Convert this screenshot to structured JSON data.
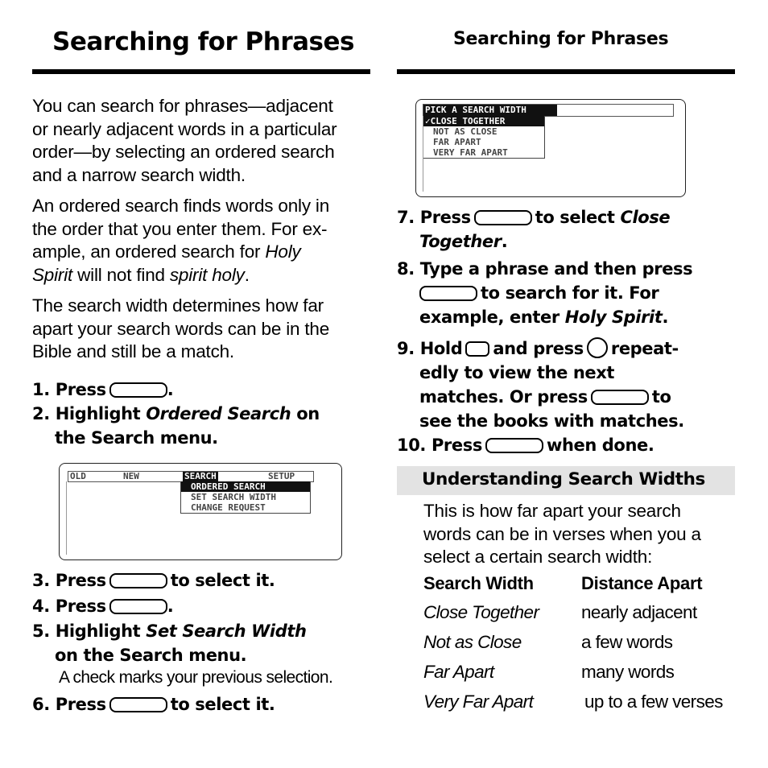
{
  "left": {
    "title": "Searching for Phrases",
    "paragraphs": [
      {
        "lines": [
          "You can search for phrases—adjacent",
          "or nearly adjacent words in a particular",
          "order—by selecting an ordered search",
          "and a narrow search width."
        ]
      },
      {
        "l1": "An ordered search finds words only in",
        "l2": "the order that you enter them. For ex-",
        "l3_pre": "ample, an ordered search for ",
        "l3_it": "Holy",
        "l4_it1": "Spirit",
        "l4_mid": " will not find ",
        "l4_it2": "spirit holy",
        "l4_end": "."
      },
      {
        "lines": [
          "The search width determines how far",
          "apart your search words can be in the",
          "Bible and still be a match."
        ]
      }
    ],
    "steps": {
      "s1": {
        "num": "1.",
        "pre": "Press",
        "post": "."
      },
      "s2": {
        "num": "2.",
        "pre": "Highlight ",
        "it": "Ordered Search",
        "post": " on",
        "cont": "the Search menu."
      },
      "s3": {
        "num": "3.",
        "pre": "Press",
        "post": "to select it."
      },
      "s4": {
        "num": "4.",
        "pre": "Press",
        "post": "."
      },
      "s5": {
        "num": "5.",
        "pre": "Highlight ",
        "it": "Set Search Width",
        "cont": "on the Search menu."
      },
      "s5_note": "A check marks your previous selection.",
      "s6": {
        "num": "6.",
        "pre": "Press",
        "post": "to select it."
      }
    },
    "screen1": {
      "menubar": [
        "OLD",
        "NEW",
        "SEARCH",
        "SETUP"
      ],
      "selected_menu": "SEARCH",
      "dropdown": [
        "ORDERED SEARCH",
        "SET SEARCH WIDTH",
        "CHANGE REQUEST"
      ],
      "selected_item": "ORDERED SEARCH"
    }
  },
  "right": {
    "title": "Searching for Phrases",
    "screen2": {
      "prompt": "PICK A SEARCH WIDTH",
      "options": [
        "✓CLOSE TOGETHER",
        "NOT AS CLOSE",
        "FAR APART",
        "VERY FAR APART"
      ],
      "selected": "✓CLOSE TOGETHER"
    },
    "steps": {
      "s7": {
        "num": "7.",
        "pre": "Press",
        "post": "to select ",
        "it1": "Close",
        "it2": "Together",
        "end": "."
      },
      "s8": {
        "num": "8.",
        "l1": "Type a phrase and then press",
        "l2_post": "to search for it. For",
        "l3_pre": "example, enter ",
        "l3_it": "Holy Spirit",
        "l3_end": "."
      },
      "s9": {
        "num": "9.",
        "pre": "Hold",
        "mid": "and press",
        "post": "repeat-",
        "l2": "edly to view the next",
        "l3_pre": "matches. Or press",
        "l3_post": "to",
        "l4": "see the books with matches."
      },
      "s10": {
        "num": "10.",
        "pre": "Press",
        "post": "when done."
      }
    },
    "section": {
      "heading": "Understanding Search Widths",
      "intro": [
        "This is how far apart your search",
        "words can be in verses when you a",
        "select a certain search width:"
      ],
      "table": {
        "headers": [
          "Search Width",
          "Distance Apart"
        ],
        "rows": [
          [
            "Close Together",
            "nearly adjacent"
          ],
          [
            "Not as Close",
            "a few words"
          ],
          [
            "Far Apart",
            "many words"
          ],
          [
            "Very Far Apart",
            "up to a few verses"
          ]
        ]
      }
    }
  }
}
